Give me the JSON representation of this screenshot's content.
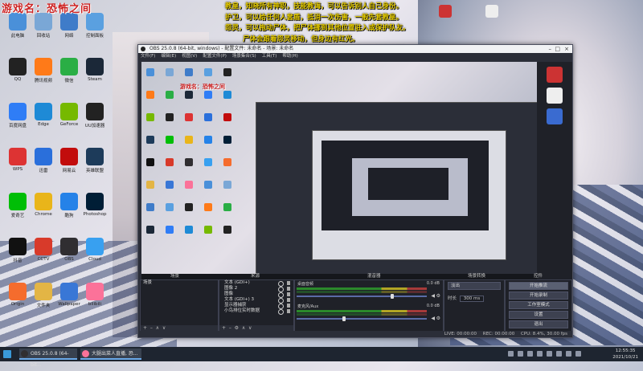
{
  "overlay_title": "游戏名：恐怖之间",
  "notice_lines": [
    "教皇，知晓所有神职，技能教诲，可以告诉别人自己身份。",
    "护卫，可以给任何人套盾，抵消一次伤害，一般先套教皇。",
    "怨灵，可以拖动尸体，把尸体挪到其他位置驻入或保护队友。",
    "尸体会跟着怨灵移动，但身边有红光。",
    "吾画鬼，可以标记任何人，然后变成他的模样（包括号码牌），",
    "到达教堂之后，会变回原样",
    "幽灵，能够短暂隐身，创造不在场证明与打出时间差",
    "刷灵，开局可以被人看到其他的某个职业"
  ],
  "desktop_icons": [
    {
      "label": "此电脑",
      "color": "#4a90d9"
    },
    {
      "label": "回收站",
      "color": "#7aa7d6"
    },
    {
      "label": "网络",
      "color": "#3f7cc9"
    },
    {
      "label": "控制面板",
      "color": "#5aa0e0"
    },
    {
      "label": "QQ",
      "color": "#222222"
    },
    {
      "label": "腾讯视频",
      "color": "#ff7a18"
    },
    {
      "label": "微信",
      "color": "#2aae45"
    },
    {
      "label": "Steam",
      "color": "#1b2838"
    },
    {
      "label": "百度网盘",
      "color": "#2f7df6"
    },
    {
      "label": "Edge",
      "color": "#1e8ad6"
    },
    {
      "label": "GeForce",
      "color": "#76b900"
    },
    {
      "label": "UU加速器",
      "color": "#222222"
    },
    {
      "label": "WPS",
      "color": "#d33"
    },
    {
      "label": "迅雷",
      "color": "#2a6fdb"
    },
    {
      "label": "网易云",
      "color": "#c20c0c"
    },
    {
      "label": "英雄联盟",
      "color": "#1d3b5a"
    },
    {
      "label": "爱奇艺",
      "color": "#00be06"
    },
    {
      "label": "Chrome",
      "color": "#e9b51a"
    },
    {
      "label": "酷狗",
      "color": "#2582e8"
    },
    {
      "label": "Photoshop",
      "color": "#001e36"
    },
    {
      "label": "抖音",
      "color": "#111"
    },
    {
      "label": "CCTV",
      "color": "#d83a2a"
    },
    {
      "label": "OBS",
      "color": "#302e31"
    },
    {
      "label": "Cloud",
      "color": "#38a0f0"
    },
    {
      "label": "Origin",
      "color": "#f56c2d"
    },
    {
      "label": "文件夹",
      "color": "#e3b545"
    },
    {
      "label": "Wallpaper",
      "color": "#3977d6"
    },
    {
      "label": "bilibili",
      "color": "#fb7299"
    }
  ],
  "obs": {
    "title": "OBS 25.0.8 (64-bit, windows) - 配置文件: 未命名 - 场景: 未命名",
    "menu": [
      "文件(F)",
      "编辑(E)",
      "视图(V)",
      "配置文件(P)",
      "场景集合(S)",
      "工具(T)",
      "帮助(H)"
    ],
    "dock_headers": {
      "scenes": "场景",
      "sources": "来源",
      "mixer": "混音器",
      "transitions": "场景转换",
      "controls": "控件"
    },
    "scene_item": "场景",
    "sources": [
      "文本 (GDI+)",
      "图像 2",
      "图像",
      "文本 (GDI+) 3",
      "显示器捕获",
      "小鸟排位实时数据"
    ],
    "mixer": [
      {
        "label": "桌面音频",
        "db": "0.0 dB",
        "level": 0.72
      },
      {
        "label": "麦克风/Aux",
        "db": "0.0 dB",
        "level": 0.35
      }
    ],
    "transition": {
      "type": "淡出",
      "duration_label": "时长",
      "duration": "300 ms"
    },
    "controls": [
      "开始推流",
      "开始录制",
      "工作室模式",
      "设置",
      "退出"
    ],
    "controls_active": [
      "开始推流"
    ],
    "status": {
      "live": "LIVE: 00:00:00",
      "rec": "REC: 00:00:00",
      "cpu": "CPU: 8.4%, 30.00 fps"
    }
  },
  "taskbar": {
    "apps": [
      {
        "label": "OBS 25.0.8 (64-bit...",
        "color": "#302e31"
      },
      {
        "label": "大腿出菜人直播, 恐...",
        "color": "#fb7299"
      }
    ],
    "time": "12:55:35",
    "date": "2021/10/21"
  }
}
